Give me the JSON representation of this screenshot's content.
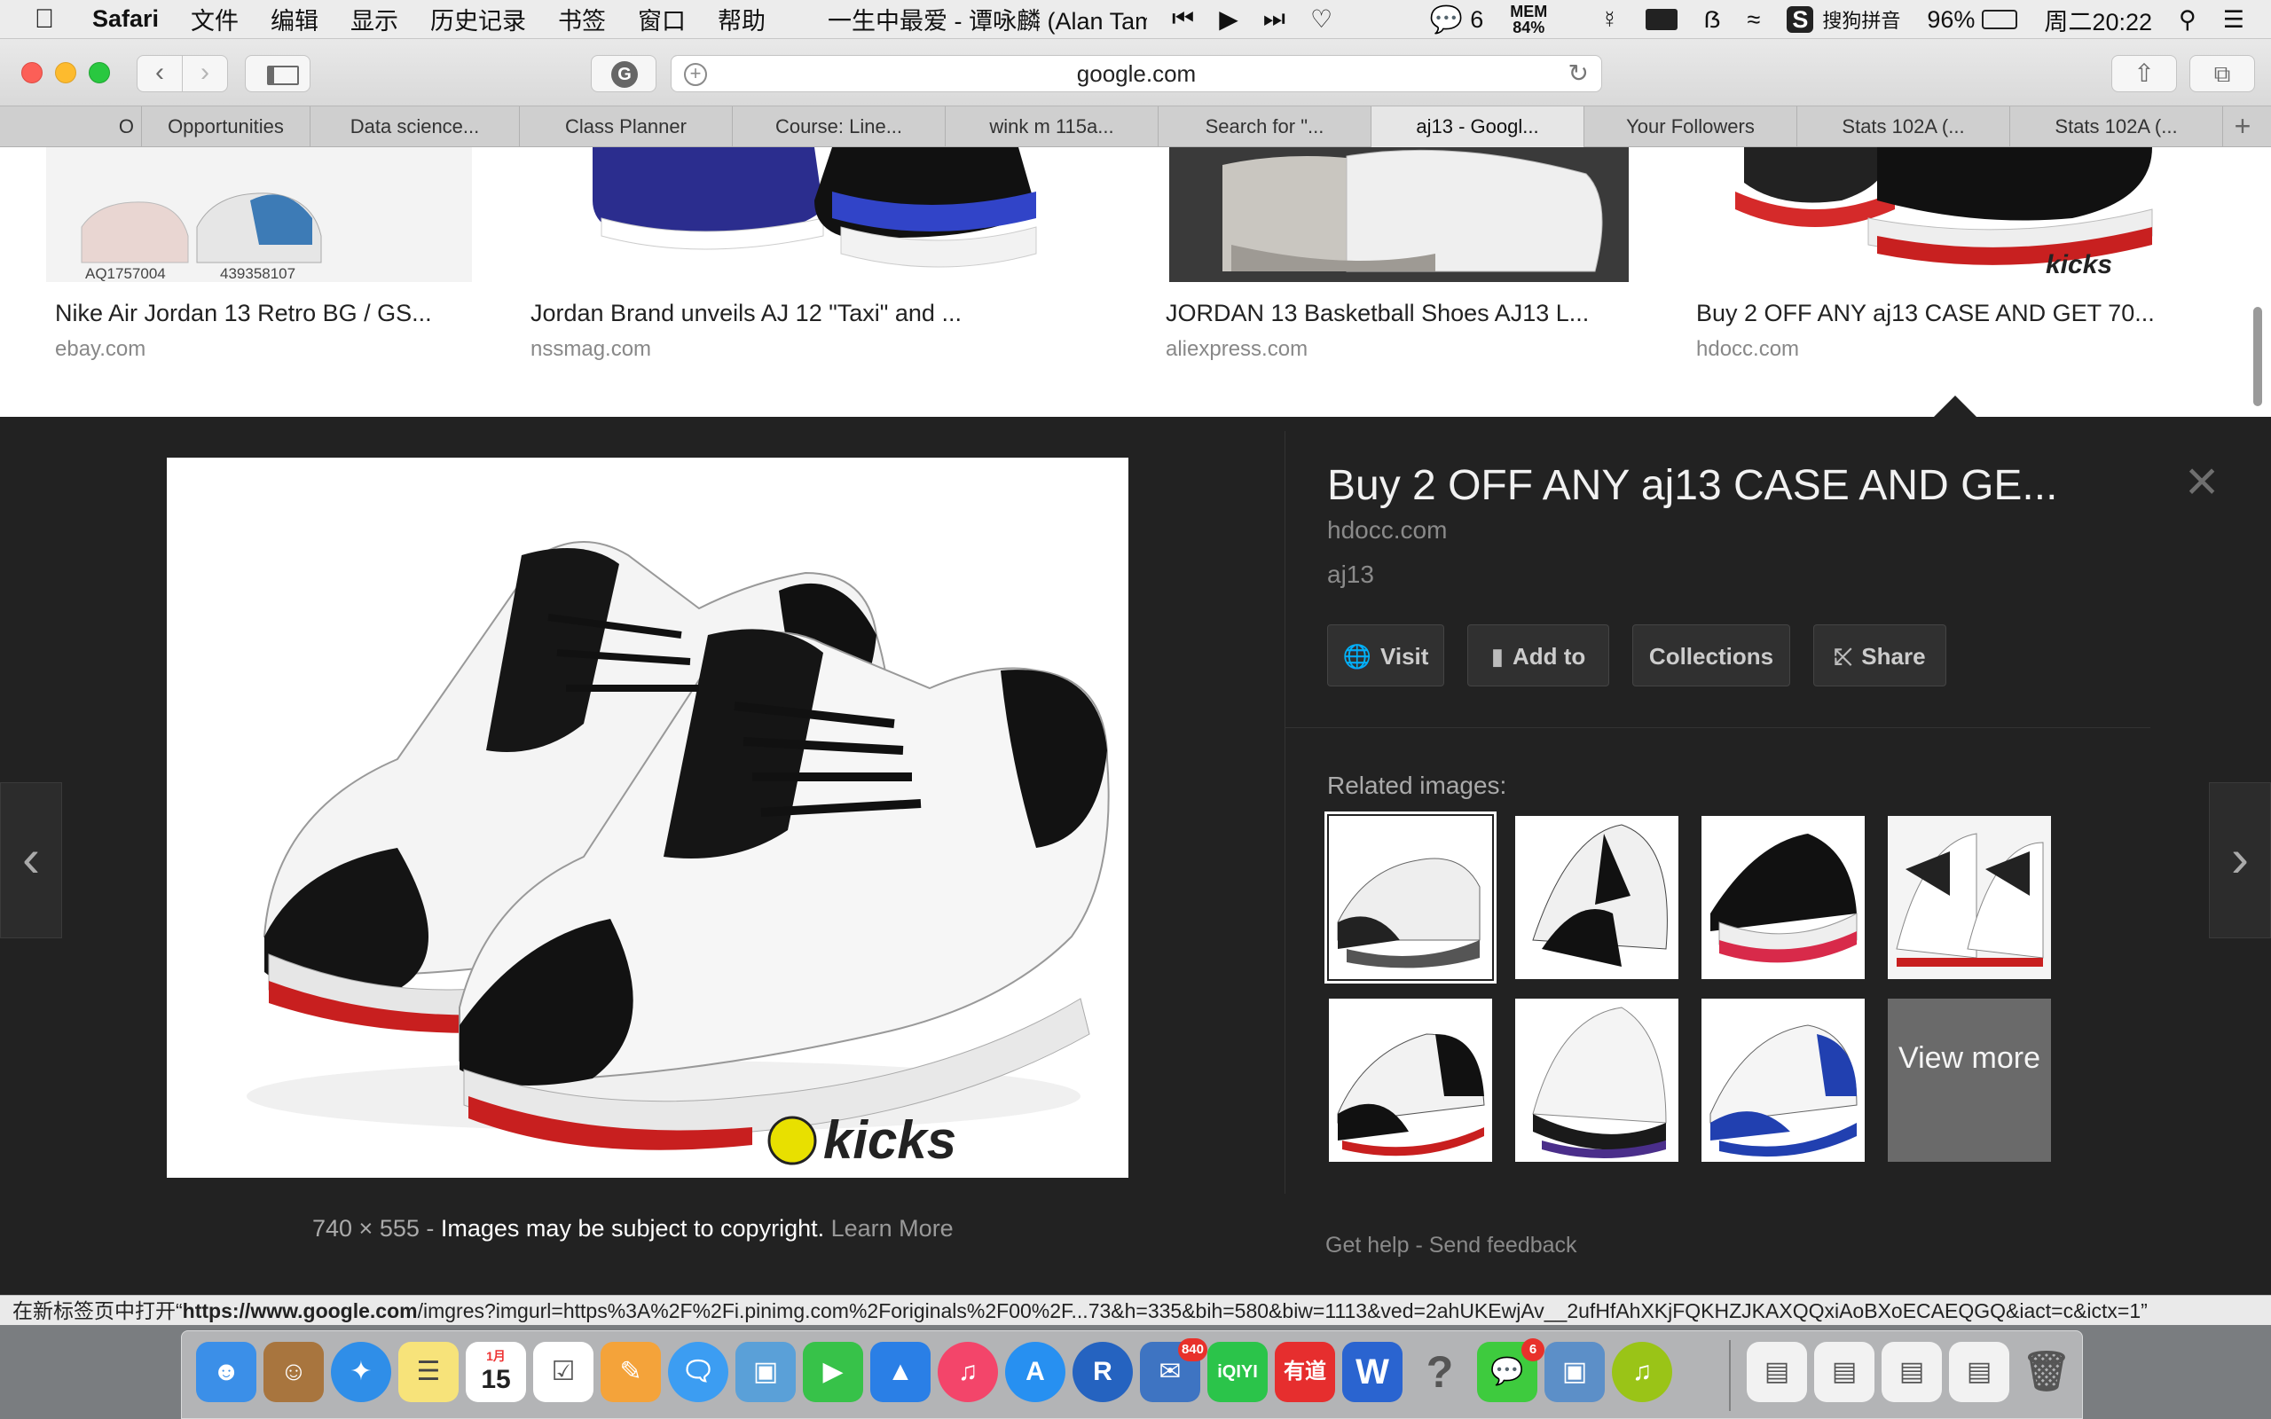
{
  "menubar": {
    "app_name": "Safari",
    "menus": [
      "文件",
      "编辑",
      "显示",
      "历史记录",
      "书签",
      "窗口",
      "帮助"
    ],
    "now_playing": "一生中最爱 - 谭咏麟 (Alan Tam)",
    "wechat_count": "6",
    "mem_label": "MEM",
    "mem_value": "84%",
    "input_method": "搜狗拼音",
    "battery": "96%",
    "clock": "周二20:22"
  },
  "toolbar": {
    "url": "google.com"
  },
  "tabs": [
    {
      "label": "O"
    },
    {
      "label": "Opportunities"
    },
    {
      "label": "Data science..."
    },
    {
      "label": "Class Planner"
    },
    {
      "label": "Course: Line..."
    },
    {
      "label": "wink m 115a..."
    },
    {
      "label": "Search for \"..."
    },
    {
      "label": "aj13 - Googl..."
    },
    {
      "label": "Your Followers"
    },
    {
      "label": "Stats 102A (..."
    },
    {
      "label": "Stats 102A (..."
    }
  ],
  "results": [
    {
      "caption": "Nike Air Jordan 13 Retro BG / GS...",
      "source": "ebay.com",
      "codes": [
        "AQ1757004",
        "439358107"
      ]
    },
    {
      "caption": "Jordan Brand unveils AJ 12 \"Taxi\" and ...",
      "source": "nssmag.com"
    },
    {
      "caption": "JORDAN 13 Basketball Shoes AJ13 L...",
      "source": "aliexpress.com"
    },
    {
      "caption": "Buy 2 OFF ANY aj13 CASE AND GET 70...",
      "source": "hdocc.com"
    }
  ],
  "detail": {
    "title": "Buy 2 OFF ANY aj13 CASE AND GE...",
    "domain": "hdocc.com",
    "query": "aj13",
    "buttons": {
      "visit": "Visit",
      "add_to": "Add to",
      "collections": "Collections",
      "share": "Share"
    },
    "related_label": "Related images:",
    "view_more": "View more",
    "dimensions": "740 × 555",
    "copyright": "Images may be subject to copyright.",
    "learn_more": "Learn More",
    "get_help": "Get help",
    "send_feedback": "Send feedback",
    "watermark": "kicks"
  },
  "status_bar": {
    "prefix": "在新标签页中打开“",
    "host": "https://www.google.com",
    "path": "/imgres?imgurl=https%3A%2F%2Fi.pinimg.com%2Foriginals%2F00%2F...73&h=335&bih=580&biw=1113&ved=2ahUKEwjAv__2ufHfAhXKjFQKHZJKAXQQxiAoBXoECAEQGQ&iact=c&ictx=1”"
  },
  "dock": {
    "calendar_month": "1月",
    "calendar_day": "15",
    "mail_badge": "840",
    "wechat_badge": "6",
    "iqiyi_label": "iQIYI",
    "youdao_label": "有道"
  }
}
